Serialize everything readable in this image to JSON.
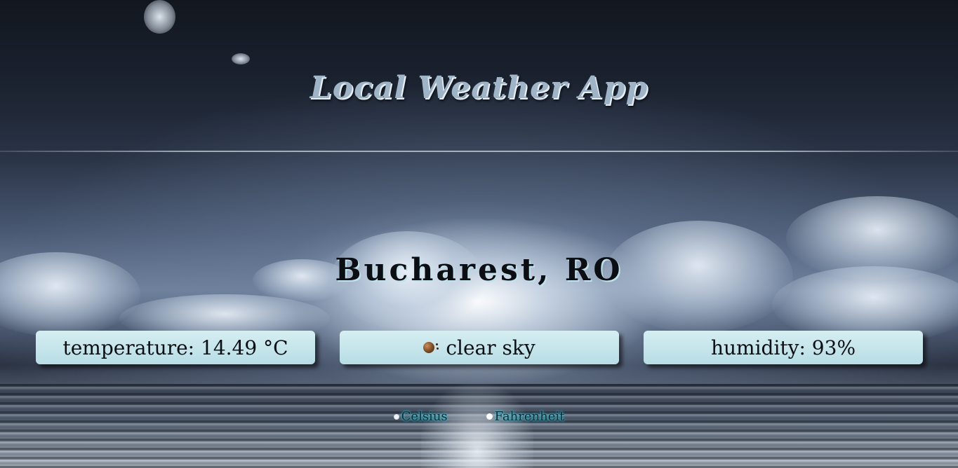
{
  "header": {
    "title": "Local Weather App"
  },
  "location": {
    "label": "Bucharest, RO"
  },
  "cards": {
    "temperature": "temperature: 14.49 °C",
    "description": "clear sky",
    "humidity": "humidity: 93%"
  },
  "weather_icon": "clear-sky-icon",
  "units": {
    "celsius_label": "Celsius",
    "fahrenheit_label": "Fahrenheit",
    "selected": "Celsius"
  },
  "colors": {
    "card_background": "#c6e6ec",
    "title_color": "#9fb4c6",
    "unit_glow": "#2bb6cc"
  }
}
